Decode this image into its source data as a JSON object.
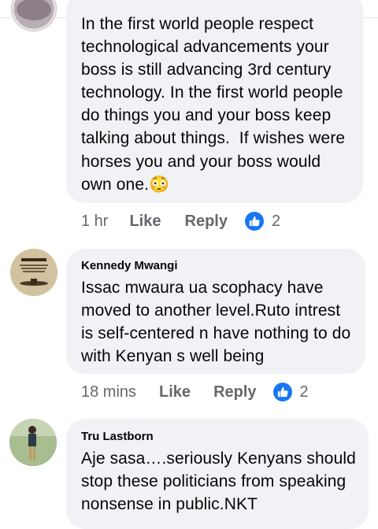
{
  "comments": [
    {
      "author": "",
      "text": "In the first world people respect technological advancements your boss is still advancing 3rd century technology. In the first world people do things you and your boss keep talking about things.  If wishes were horses you and your boss would own one.",
      "emoji": "😳",
      "time": "1 hr",
      "like_label": "Like",
      "reply_label": "Reply",
      "reaction_icon": "thumbs-up-icon",
      "reaction_count": "2"
    },
    {
      "author": "Kennedy Mwangi",
      "text": "Issac mwaura ua scophacy have moved to another level.Ruto intrest is self-centered n have nothing to do with Kenyan s well being",
      "avatar_text": "ALLAH",
      "time": "18 mins",
      "like_label": "Like",
      "reply_label": "Reply",
      "reaction_icon": "thumbs-up-icon",
      "reaction_count": "2"
    },
    {
      "author": "Tru Lastborn",
      "text": "Aje sasa….seriously Kenyans should stop these politicians from speaking nonsense in public.NKT"
    }
  ],
  "colors": {
    "bubble": "#f0f2f5",
    "text": "#050505",
    "meta": "#65676b",
    "like_blue": "#1877f2"
  }
}
